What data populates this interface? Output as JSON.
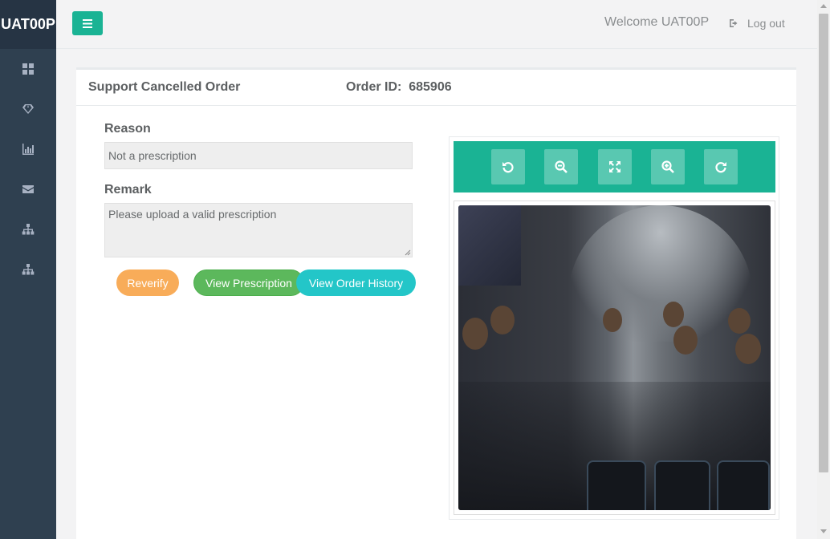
{
  "brand": "UAT00P",
  "sidebar": {
    "items": [
      {
        "icon": "dashboard-icon"
      },
      {
        "icon": "diamond-icon"
      },
      {
        "icon": "bar-chart-icon"
      },
      {
        "icon": "envelope-icon"
      },
      {
        "icon": "sitemap-icon"
      },
      {
        "icon": "sitemap-icon"
      }
    ]
  },
  "topbar": {
    "welcome": "Welcome UAT00P",
    "logout": "Log out"
  },
  "panel": {
    "title": "Support Cancelled Order",
    "order_label": "Order ID:",
    "order_id": "685906",
    "reason_label": "Reason",
    "reason_value": "Not a prescription",
    "remark_label": "Remark",
    "remark_value": "Please upload a valid prescription"
  },
  "buttons": {
    "reverify": "Reverify",
    "view_prescription": "View Prescription",
    "view_order_history": "View Order History"
  },
  "viewer": {
    "tools": [
      "rotate-left-icon",
      "zoom-out-icon",
      "fit-expand-icon",
      "zoom-in-icon",
      "rotate-right-icon"
    ]
  },
  "colors": {
    "accent": "#1ab394",
    "sidebar": "#2f4050",
    "warning": "#f8ac59",
    "success": "#5cb85c",
    "info": "#23c6c8"
  }
}
